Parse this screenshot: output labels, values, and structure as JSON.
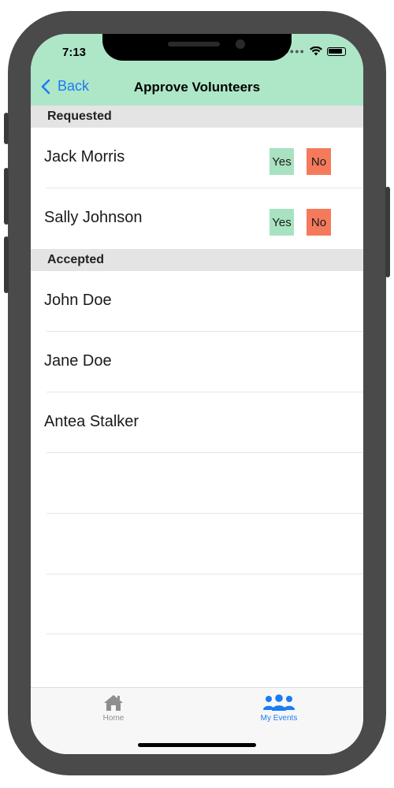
{
  "status_bar": {
    "time": "7:13"
  },
  "nav": {
    "back_label": "Back",
    "title": "Approve Volunteers"
  },
  "sections": {
    "requested": {
      "title": "Requested",
      "rows": [
        {
          "name": "Jack Morris",
          "yes": "Yes",
          "no": "No"
        },
        {
          "name": "Sally Johnson",
          "yes": "Yes",
          "no": "No"
        }
      ]
    },
    "accepted": {
      "title": "Accepted",
      "rows": [
        {
          "name": "John Doe"
        },
        {
          "name": "Jane Doe"
        },
        {
          "name": "Antea Stalker"
        }
      ]
    }
  },
  "tabs": [
    {
      "label": "Home",
      "icon": "home-icon",
      "active": false
    },
    {
      "label": "My Events",
      "icon": "people-icon",
      "active": true
    }
  ],
  "colors": {
    "header_bg": "#aee6c8",
    "accent": "#1a7cf5",
    "yes_bg": "#a9e2c1",
    "no_bg": "#f57a5c",
    "section_bg": "#e4e4e4",
    "tab_inactive": "#8e8e8e"
  }
}
